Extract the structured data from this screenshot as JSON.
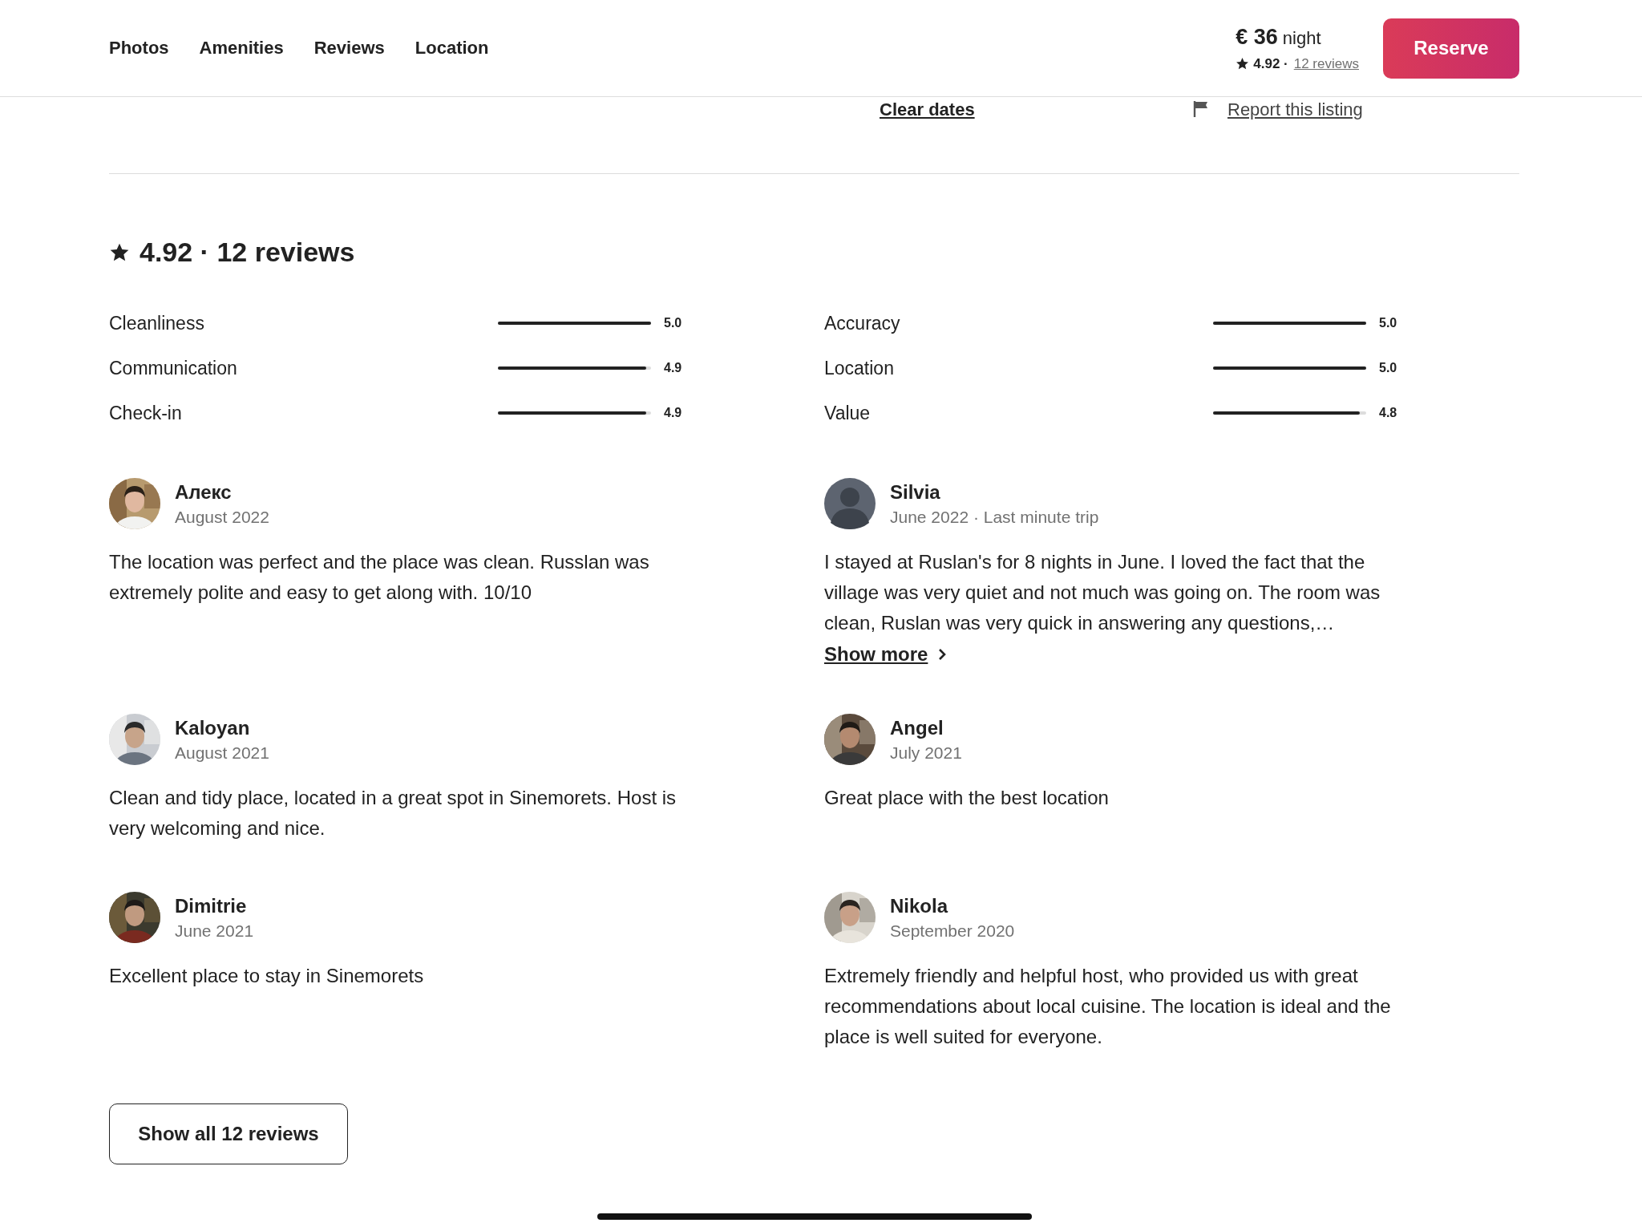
{
  "nav": {
    "links": [
      {
        "label": "Photos"
      },
      {
        "label": "Amenities"
      },
      {
        "label": "Reviews"
      },
      {
        "label": "Location"
      }
    ]
  },
  "price": {
    "amount": "€ 36",
    "unit": "night",
    "rating": "4.92 ·",
    "reviews_link": "12 reviews"
  },
  "reserve_button": "Reserve",
  "peek": {
    "clear_dates": "Clear dates",
    "report_link": "Report this listing"
  },
  "summary": {
    "title": "4.92 · 12 reviews"
  },
  "categories": [
    {
      "name": "Cleanliness",
      "level": 1.0,
      "score": "5.0"
    },
    {
      "name": "Accuracy",
      "level": 1.0,
      "score": "5.0"
    },
    {
      "name": "Communication",
      "level": 0.97,
      "score": "4.9"
    },
    {
      "name": "Location",
      "level": 1.0,
      "score": "5.0"
    },
    {
      "name": "Check-in",
      "level": 0.97,
      "score": "4.9"
    },
    {
      "name": "Value",
      "level": 0.96,
      "score": "4.8"
    }
  ],
  "reviews": [
    {
      "name": "Алекс",
      "date": "August 2022",
      "kind": "picture",
      "text": "The location was perfect and the place was clean. Russlan was extremely polite and easy to get along with. 10/10"
    },
    {
      "name": "Silvia",
      "date": "June 2022 · Last minute trip",
      "kind": "silhouette",
      "text": "I stayed at Ruslan's for 8 nights in June. I loved the fact that the village was very quiet and not much was going on. The room was clean, Ruslan was very quick in answering any questions,…",
      "show_more": "Show more"
    },
    {
      "name": "Kaloyan",
      "date": "August 2021",
      "kind": "picture",
      "text": "Clean and tidy place, located in a great spot in Sinemorets. Host is very welcoming and nice."
    },
    {
      "name": "Angel",
      "date": "July 2021",
      "kind": "picture",
      "text": "Great place with the best location"
    },
    {
      "name": "Dimitrie",
      "date": "June 2021",
      "kind": "picture",
      "text": "Excellent place to stay in Sinemorets"
    },
    {
      "name": "Nikola",
      "date": "September 2020",
      "kind": "picture",
      "text": "Extremely friendly and helpful host, who provided us with great recommendations about local cuisine. The location is ideal and the place is well suited for everyone."
    }
  ],
  "show_all_button": "Show all 12 reviews"
}
